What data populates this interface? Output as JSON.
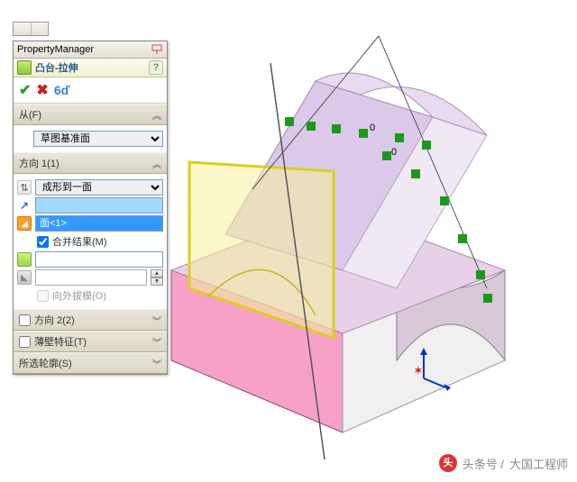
{
  "pm": {
    "title": "PropertyManager"
  },
  "feature": {
    "title": "凸台-拉伸",
    "help": "?"
  },
  "actions": {
    "ok": "✔",
    "cancel": "✖",
    "preview": "6ď"
  },
  "sections": {
    "from": {
      "label": "从(F)",
      "plane_option": "草图基准面"
    },
    "dir1": {
      "label": "方向 1(1)",
      "end_condition": "成形到一面",
      "face_selected": "面<1>",
      "merge_label": "合并结果(M)",
      "draft_label": "向外拔模(O)"
    },
    "dir2": {
      "label": "方向 2(2)"
    },
    "thin": {
      "label": "薄壁特征(T)"
    },
    "contours": {
      "label": "所选轮廓(S)"
    }
  },
  "watermark": {
    "prefix": "头条号 /",
    "author": "大国工程师",
    "logo": "头"
  },
  "sketch_dims": {
    "d0a": "0",
    "d0b": "0"
  }
}
